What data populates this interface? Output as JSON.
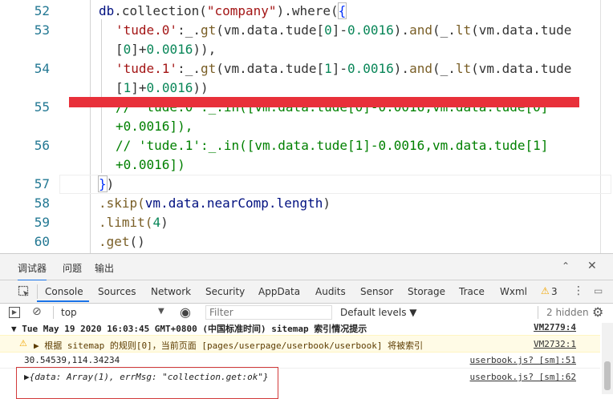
{
  "editor": {
    "line_numbers": [
      "52",
      "53",
      "54",
      "55",
      "56",
      "57",
      "58",
      "59",
      "60"
    ],
    "lines": {
      "l52": {
        "a": "db",
        "b": ".collection(",
        "c": "\"company\"",
        "d": ").where(",
        "e": "{"
      },
      "l53a": {
        "a": "'tude.0'",
        "b": ":_.",
        "c": "gt",
        "d": "(vm.data.tude[",
        "e": "0",
        "f": "]-",
        "g": "0.0016",
        "h": ").",
        "i": "and",
        "j": "(_.",
        "k": "lt",
        "l": "(vm.data.tude"
      },
      "l53b": {
        "a": "[",
        "b": "0",
        "c": "]+",
        "d": "0.0016",
        "e": ")),"
      },
      "l54a": {
        "a": "'tude.1'",
        "b": ":_.",
        "c": "gt",
        "d": "(vm.data.tude[",
        "e": "1",
        "f": "]-",
        "g": "0.0016",
        "h": ").",
        "i": "and",
        "j": "(_.",
        "k": "lt",
        "l": "(vm.data.tude"
      },
      "l54b": {
        "a": "[",
        "b": "1",
        "c": "]+",
        "d": "0.0016",
        "e": "))"
      },
      "l55a": "// 'tude.0':_.in([vm.data.tude[0]-0.0016,vm.data.tude[0]",
      "l55b": "+0.0016]),",
      "l56a": "// 'tude.1':_.in([vm.data.tude[1]-0.0016,vm.data.tude[1]",
      "l56b": "+0.0016])",
      "l57": {
        "a": "}",
        "b": ")"
      },
      "l58": {
        "a": ".skip(",
        "b": "vm.data.nearComp.length",
        "c": ")"
      },
      "l59": {
        "a": ".limit(",
        "b": "4",
        "c": ")"
      },
      "l60": {
        "a": ".get",
        "b": "()"
      }
    }
  },
  "drawer": {
    "tabs": [
      "调试器",
      "问题",
      "输出"
    ],
    "icons": {
      "collapse": "chevron-up-icon",
      "close": "close-icon"
    }
  },
  "panel_tabs": [
    "Console",
    "Sources",
    "Network",
    "Security",
    "AppData",
    "Audits",
    "Sensor",
    "Storage",
    "Trace",
    "Wxml"
  ],
  "warning_count": "3",
  "toolbar": {
    "context": "top",
    "filter_placeholder": "Filter",
    "levels": "Default levels ▼",
    "hidden": "2 hidden"
  },
  "console": {
    "lines": [
      {
        "text": "▼ Tue May 19 2020 16:03:45 GMT+0800 (中国标准时间) sitemap 索引情况提示",
        "src": "VM2779:4"
      },
      {
        "text": "▶ 根据 sitemap 的规则[0]，当前页面 [pages/userpage/userbook/userbook] 将被索引",
        "src": "VM2732:1"
      },
      {
        "text": "30.54539,114.34234",
        "src": "userbook.js? [sm]:51"
      },
      {
        "text": "▶{data: Array(1), errMsg: \"collection.get:ok\"}",
        "src": "userbook.js? [sm]:62"
      }
    ]
  },
  "colors": {
    "accent": "#1a73e8",
    "warning": "#f2a600",
    "highlight": "#d23a3a",
    "redline": "#e8303a"
  }
}
